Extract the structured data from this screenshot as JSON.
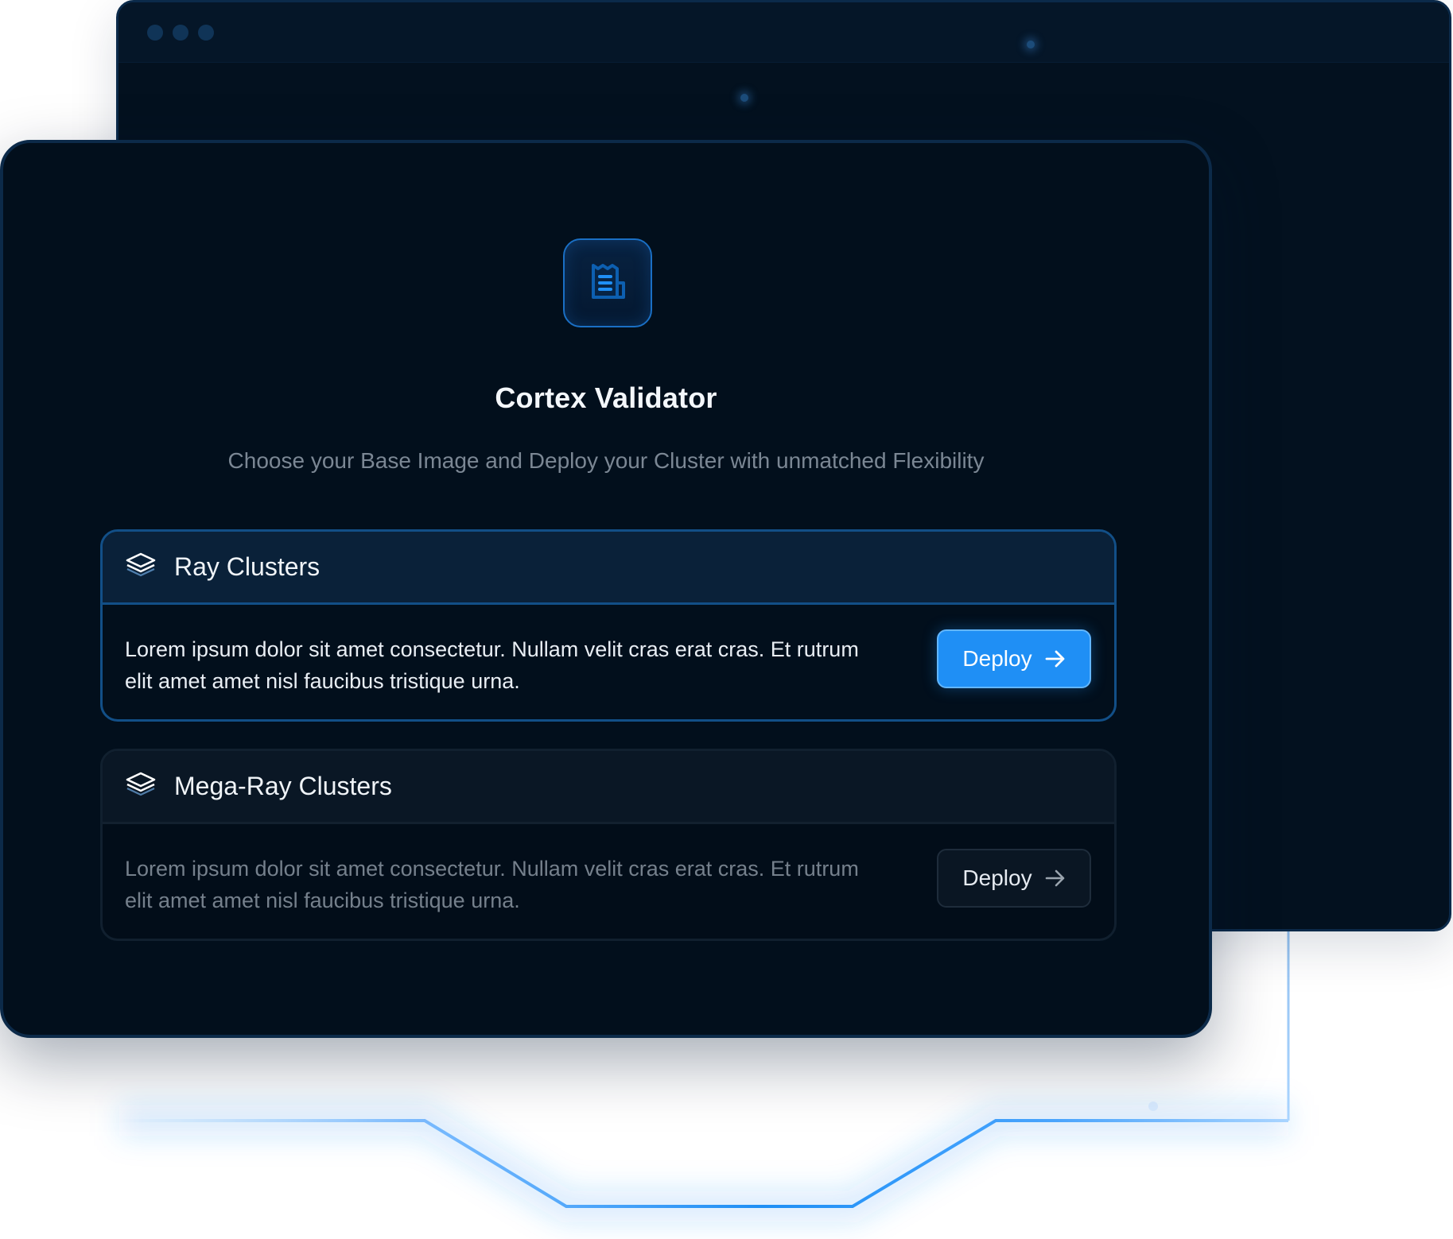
{
  "app": {
    "title": "Cortex Validator",
    "subtitle": "Choose your Base Image and Deploy your Cluster with unmatched Flexibility",
    "icon": "document-icon"
  },
  "clusters": [
    {
      "name": "Ray Clusters",
      "icon": "layers-icon",
      "description": "Lorem ipsum dolor sit amet consectetur. Nullam velit cras erat cras. Et rutrum elit amet amet nisl faucibus tristique urna.",
      "button_label": "Deploy",
      "button_icon": "arrow-right-icon",
      "state": "active"
    },
    {
      "name": "Mega-Ray Clusters",
      "icon": "layers-icon",
      "description": "Lorem ipsum dolor sit amet consectetur. Nullam velit cras erat cras. Et rutrum elit amet amet nisl faucibus tristique urna.",
      "button_label": "Deploy",
      "button_icon": "arrow-right-icon",
      "state": "inactive"
    }
  ],
  "colors": {
    "accent": "#1f8ff5",
    "background": "#020f1c",
    "border_active": "#124f87",
    "text_muted": "#7b8794"
  }
}
